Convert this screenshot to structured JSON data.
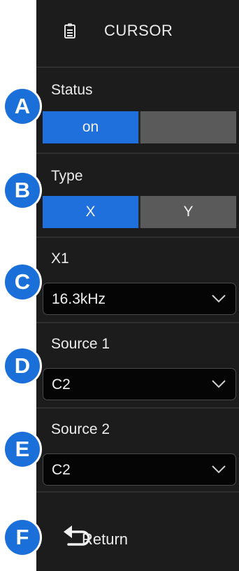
{
  "header": {
    "title": "CURSOR",
    "icon": "document-list-icon"
  },
  "status": {
    "label": "Status",
    "options": [
      "on",
      ""
    ],
    "selected": "on",
    "badge": "A"
  },
  "type": {
    "label": "Type",
    "options": [
      "X",
      "Y"
    ],
    "selected": "X",
    "badge": "B"
  },
  "x1": {
    "label": "X1",
    "value": "16.3kHz",
    "badge": "C"
  },
  "source1": {
    "label": "Source 1",
    "value": "C2",
    "badge": "D"
  },
  "source2": {
    "label": "Source 2",
    "value": "C2",
    "badge": "E"
  },
  "return_item": {
    "label": "Return",
    "icon": "return-arrow-icon",
    "badge": "F"
  },
  "colors": {
    "accent": "#1f6fdc",
    "panel": "#1c1c1c",
    "inactive": "#5a5a5a"
  }
}
